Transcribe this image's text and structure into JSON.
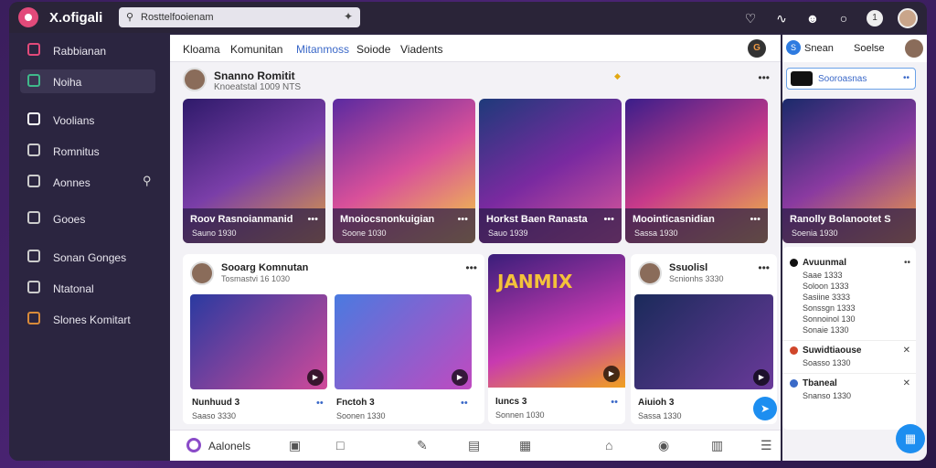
{
  "app": {
    "title": "X.ofigali"
  },
  "search": {
    "value": "Rosttelfooienam",
    "tool_icon": "wand-icon"
  },
  "topbar": {
    "icons": [
      "bell-icon",
      "activity-icon",
      "chat-icon",
      "heart-icon",
      "badge-icon"
    ],
    "badge_text": "1"
  },
  "sidebar": {
    "items": [
      {
        "label": "Rabbianan",
        "icon": "grid-icon",
        "color": "#e24a7a"
      },
      {
        "label": "Noiha",
        "icon": "home-icon",
        "color": "#3fb98a",
        "active": true
      },
      {
        "label": "Voolians",
        "icon": "video-icon",
        "color": "#ffffff"
      },
      {
        "label": "Romnitus",
        "icon": "user-icon",
        "color": "#cccccc"
      },
      {
        "label": "Aonnes",
        "icon": "game-icon",
        "color": "#cccccc"
      },
      {
        "label": "Gooes",
        "icon": "list-icon",
        "color": "#cccccc"
      },
      {
        "label": "Sonan Gonges",
        "icon": "calendar-icon",
        "color": "#cccccc"
      },
      {
        "label": "Ntatonal",
        "icon": "globe-icon",
        "color": "#cccccc"
      },
      {
        "label": "Slones Komitart",
        "icon": "ball-icon",
        "color": "#d88a3a"
      }
    ]
  },
  "nav": {
    "tabs": [
      "Kloama",
      "Komunitan",
      "Mitanmoss",
      "Soiode",
      "Viadents"
    ],
    "active_index": 2,
    "avatar_letter": "G"
  },
  "feed": {
    "header": {
      "name": "Snanno Romitit",
      "sub": "Knoeatstal 1009 NTS"
    },
    "cards": [
      {
        "title": "Roov Rasnoianmanid",
        "meta": "Sauno 1930",
        "colors": [
          "#2e1a6a",
          "#7a3ea8",
          "#e0a040"
        ]
      },
      {
        "title": "Mnoiocsnonkuigian",
        "meta": "Soone 1030",
        "colors": [
          "#5a2aa0",
          "#d8509a",
          "#f4d040"
        ]
      },
      {
        "title": "Horkst Baen Ranasta",
        "meta": "Sauo 1939",
        "colors": [
          "#1e3a7a",
          "#7a2aa0",
          "#e05a9a"
        ]
      },
      {
        "title": "Moointicasnidian",
        "meta": "Sassa 1930",
        "colors": [
          "#3a1e8a",
          "#c83a8a",
          "#f0c040"
        ]
      }
    ],
    "posts": [
      {
        "name": "Sooarg Komnutan",
        "sub": "Tosmastvi 16 1030",
        "foot": "Nunhuud 3",
        "foot_meta": "Saaso 3330",
        "thumbs": [
          [
            "#2a3aa0",
            "#d04a9a"
          ],
          [
            "#4a7ae0",
            "#c04ac0"
          ]
        ]
      },
      {
        "name": "Ssuolisl",
        "sub": "Scnionhs 3330",
        "foot": "Aiuioh 3",
        "foot_meta": "Sassa 1330",
        "thumbs": [
          [
            "#1a2a5a",
            "#6a3a9a"
          ],
          [
            "#2a1a4a",
            "#8a2aa0"
          ]
        ]
      }
    ],
    "center_card": {
      "title": "JANMIX",
      "foot": "Iuncs 3",
      "foot_meta": "Sonnen 1030",
      "colors": [
        "#3a1e7a",
        "#c83ab0",
        "#f0a020"
      ]
    },
    "center_post_foot": {
      "title": "Fnctoh 3",
      "meta": "Soonen 1330"
    }
  },
  "bottombar": {
    "label": "Aalonels",
    "icons": [
      "camera-icon",
      "box-icon",
      "pen-icon",
      "layout-icon",
      "media-icon",
      "home-icon",
      "compass-icon",
      "lock-icon",
      "menu-icon"
    ]
  },
  "right": {
    "top": {
      "letter": "S",
      "label1": "Snean",
      "label2": "Soelse"
    },
    "box": {
      "text": "Sooroasnas"
    },
    "card": {
      "title": "Ranolly Bolanootet S",
      "meta": "Soenia 1930",
      "colors": [
        "#1a2a6a",
        "#8a3aa0",
        "#f0a040"
      ]
    },
    "entries": [
      {
        "title": "Avuunmal",
        "color": "#111111",
        "lines": [
          "Saae 1333",
          "Soloon 1333",
          "Sasiine 3333",
          "Sonssgn 1333",
          "Sonnoinol 130",
          "Sonaie 1330"
        ]
      },
      {
        "title": "Suwidtiaouse",
        "color": "#d0462a",
        "lines": [
          "Soasso 1330"
        ]
      },
      {
        "title": "Tbaneal",
        "color": "#3a6ac8",
        "lines": [
          "Snanso 1330"
        ]
      }
    ]
  }
}
